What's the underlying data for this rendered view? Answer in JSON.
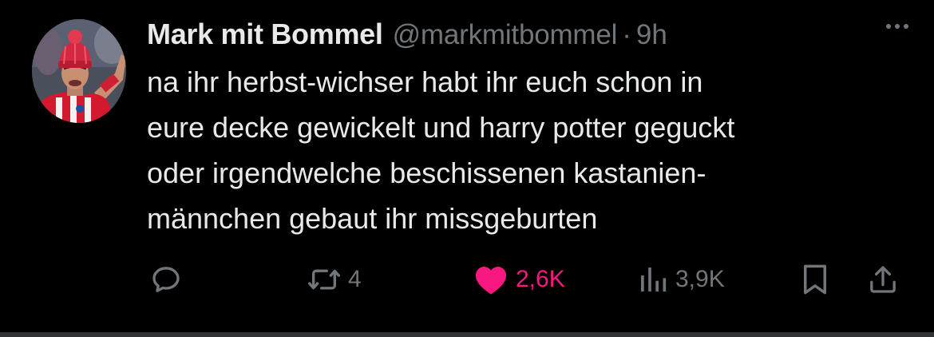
{
  "author": {
    "name": "Mark mit Bommel",
    "handle": "@markmitbommel",
    "separator": "·",
    "time": "9h"
  },
  "tweet": {
    "lines": [
      "na ihr herbst-wichser habt ihr euch schon in",
      "eure decke gewickelt und harry potter geguckt",
      "oder irgendwelche beschissenen kastanien-",
      "männchen gebaut ihr missgeburten"
    ]
  },
  "actions": {
    "reply": {
      "icon": "reply-icon",
      "count": ""
    },
    "retweet": {
      "icon": "retweet-icon",
      "count": "4"
    },
    "like": {
      "icon": "heart-icon",
      "count": "2,6K",
      "active": true
    },
    "views": {
      "icon": "views-icon",
      "count": "3,9K"
    },
    "bookmark": {
      "icon": "bookmark-icon"
    },
    "share": {
      "icon": "share-icon"
    }
  },
  "colors": {
    "background": "#000000",
    "text": "#e7e9ea",
    "muted": "#71767b",
    "like": "#f91880"
  }
}
